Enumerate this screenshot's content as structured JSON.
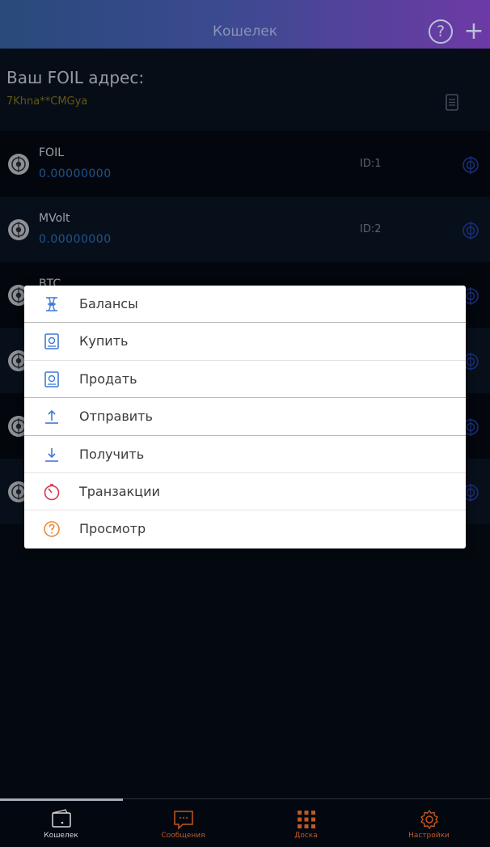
{
  "header": {
    "title": "Кошелек",
    "help_icon": "question-circle-icon",
    "add_icon": "plus-icon"
  },
  "address": {
    "label": "Ваш FOIL адрес:",
    "value": "7Khna**CMGya",
    "copy_icon": "document-copy-icon"
  },
  "coins": [
    {
      "name": "FOIL",
      "balance": "0.00000000",
      "id": "ID:1"
    },
    {
      "name": "MVolt",
      "balance": "0.00000000",
      "id": "ID:2"
    },
    {
      "name": "BTC",
      "balance": "",
      "id": ""
    },
    {
      "name": "",
      "balance": "",
      "id": ""
    },
    {
      "name": "",
      "balance": "",
      "id": ""
    },
    {
      "name": "",
      "balance": "",
      "id": ""
    }
  ],
  "menu": {
    "items": [
      {
        "label": "Балансы",
        "icon": "balance-icon"
      },
      {
        "label": "Купить",
        "icon": "buy-icon"
      },
      {
        "label": "Продать",
        "icon": "sell-icon"
      },
      {
        "label": "Отправить",
        "icon": "upload-icon"
      },
      {
        "label": "Получить",
        "icon": "download-icon"
      },
      {
        "label": "Транзакции",
        "icon": "timer-icon"
      },
      {
        "label": "Просмотр",
        "icon": "question-circle-icon"
      }
    ]
  },
  "bottom_nav": {
    "items": [
      {
        "label": "Кошелек",
        "icon": "wallet-icon",
        "active": true
      },
      {
        "label": "Сообщения",
        "icon": "chat-icon",
        "active": false
      },
      {
        "label": "Доска",
        "icon": "grid-icon",
        "active": false
      },
      {
        "label": "Настройки",
        "icon": "gear-icon",
        "active": false
      }
    ]
  },
  "colors": {
    "header_gradient_start": "#294a7a",
    "header_gradient_end": "#6d3aa6",
    "background": "#060d17",
    "balance": "#2c73c4",
    "address": "#8b7a16",
    "nav_label": "#c1581f",
    "menu_icon_blue": "#3d7ad6",
    "menu_icon_red": "#d8364e",
    "menu_icon_orange": "#e88a3a"
  }
}
